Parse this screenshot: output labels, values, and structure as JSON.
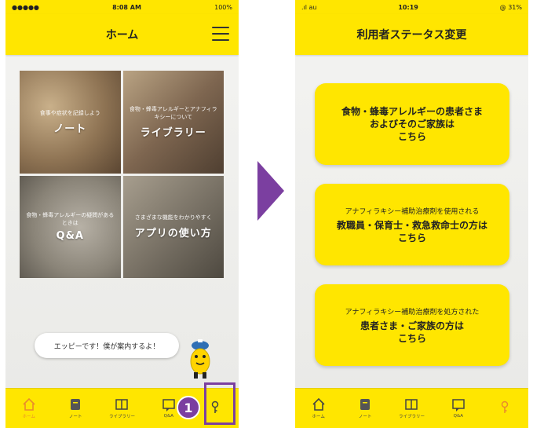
{
  "left": {
    "status": {
      "carrier": "●●●●● ",
      "time": "8:08 AM",
      "battery": "100%"
    },
    "title": "ホーム",
    "tiles": [
      {
        "sub": "食事や症状を記録しよう",
        "label": "ノート"
      },
      {
        "sub": "食物・蜂毒アレルギーとアナフィラキシーについて",
        "label": "ライブラリー"
      },
      {
        "sub": "食物・蜂毒アレルギーの疑問があるときは",
        "label": "Q&A"
      },
      {
        "sub": "さまざまな機能をわかりやすく",
        "label": "アプリの使い方"
      }
    ],
    "bubble": "エッピーです！僕が案内するよ！",
    "tabs": [
      {
        "label": "ホーム",
        "icon": "home-icon"
      },
      {
        "label": "ノート",
        "icon": "note-icon"
      },
      {
        "label": "ライブラリー",
        "icon": "book-icon"
      },
      {
        "label": "Q&A",
        "icon": "qa-icon"
      },
      {
        "label": "",
        "icon": "key-icon"
      }
    ],
    "step": "1"
  },
  "right": {
    "status": {
      "carrier": ".ıl au",
      "time": "10:19",
      "battery": "@ 31%"
    },
    "title": "利用者ステータス変更",
    "choices": [
      {
        "pre": "",
        "line1": "食物・蜂毒アレルギーの患者さま",
        "line2": "およびそのご家族は",
        "line3": "こちら"
      },
      {
        "pre": "アナフィラキシー補助治療剤を使用される",
        "line1": "教職員・保育士・救急救命士の方は",
        "line2": "こちら",
        "line3": ""
      },
      {
        "pre": "アナフィラキシー補助治療剤を処方された",
        "line1": "患者さま・ご家族の方は",
        "line2": "こちら",
        "line3": ""
      }
    ],
    "tabs": [
      {
        "label": "ホーム",
        "icon": "home-icon"
      },
      {
        "label": "ノート",
        "icon": "note-icon"
      },
      {
        "label": "ライブラリー",
        "icon": "book-icon"
      },
      {
        "label": "Q&A",
        "icon": "qa-icon"
      },
      {
        "label": "",
        "icon": "key-icon"
      }
    ]
  },
  "colors": {
    "accent": "#ffe600",
    "highlight": "#7b3fa0",
    "active": "#e98b2c"
  }
}
